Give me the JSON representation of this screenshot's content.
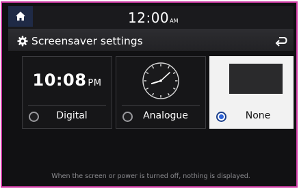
{
  "status": {
    "time": "12:00",
    "ampm": "AM"
  },
  "header": {
    "title": "Screensaver settings"
  },
  "options": [
    {
      "label": "Digital",
      "preview_time": "10:08",
      "preview_ampm": "PM",
      "selected": false
    },
    {
      "label": "Analogue",
      "selected": false
    },
    {
      "label": "None",
      "selected": true
    }
  ],
  "description": "When the screen or power is turned off, nothing is displayed.",
  "icons": {
    "home": "home-icon",
    "settings": "gear-icon",
    "back": "back-arrow-icon"
  },
  "colors": {
    "frame": "#d23ea8",
    "accent": "#2f64d8",
    "background": "#111113"
  }
}
